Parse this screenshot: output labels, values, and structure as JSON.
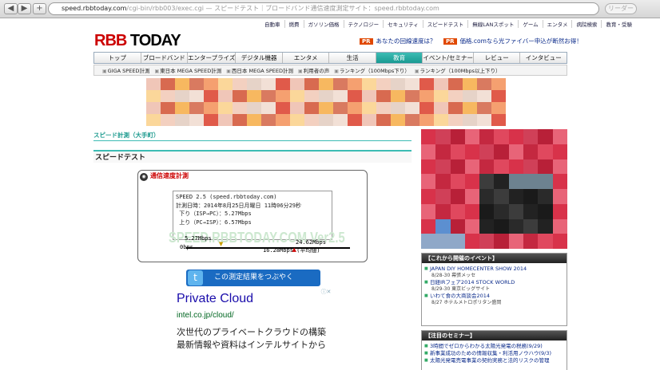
{
  "browser": {
    "url_host": "speed.rbbtoday.com",
    "url_rest": "/cgi-bin/rbb003/exec.cgi — スピードテスト｜ブロードバンド通信速度測定サイト：speed.rbbtoday.com",
    "reader_label": "リーダー",
    "back": "◀",
    "forward": "▶",
    "add": "+"
  },
  "util_links": [
    "自動車",
    "燃費",
    "ガソリン価格",
    "テクノロジー",
    "セキュリティ",
    "スピードテスト",
    "無線LANスポット",
    "ゲーム",
    "エンタメ",
    "病院検索",
    "教育・受験"
  ],
  "logo": {
    "r": "RBB",
    "rest": " TODAY"
  },
  "pr": [
    {
      "tag": "PR",
      "text": "あなたの回線速度は？"
    },
    {
      "tag": "PR",
      "text": "価格.comなら光ファイバー申込が断然お得！"
    }
  ],
  "nav": [
    "トップ",
    "ブロードバンド",
    "エンタープライズ",
    "デジタル機器",
    "エンタメ",
    "生活",
    "教育",
    "イベント/セミナー",
    "レビュー",
    "インタビュー"
  ],
  "subnav": [
    "GIGA SPEED計測",
    "東日本 MEGA SPEED計測",
    "西日本 MEGA SPEED計測",
    "利用者の声",
    "ランキング（100Mbps下り）",
    "ランキング（100Mbps以上下り）"
  ],
  "crumb": "スピード計測（大手町）",
  "heading": "スピードテスト",
  "test_box": {
    "title": "通信速度計測",
    "lines": [
      "SPEED 2.5 (speed.rbbtoday.com)",
      "計測日時：2014年8月25日月曜日 11時06分29秒",
      " 下り（ISP→PC）：5.27Mbps",
      " 上り（PC→ISP）：6.57Mbps"
    ],
    "watermark": "SPEED.RBBTODAY.COM Ver2.5",
    "current": "5.27Mbps",
    "zero": "0bps",
    "max": "24.62Mbps",
    "avg": "16.28Mbps (平均値)",
    "current_fraction": 0.214,
    "avg_fraction": 0.661
  },
  "tweet_button": "この測定結果をつぶやく",
  "ad": {
    "title": "Private Cloud",
    "url": "intel.co.jp/cloud/",
    "desc": "次世代のプライベートクラウドの構築 最新情報や資料はインテルサイトから",
    "info": "ⓘ✕"
  },
  "events": {
    "heading": "【これから開催のイベント】",
    "items": [
      {
        "title": "JAPAN DIY HOMECENTER SHOW 2014",
        "sub": "8/28-30 幕張メッセ"
      },
      {
        "title": "日経IRフェア2014 STOCK WORLD",
        "sub": "8/29-30 東京ビッグサイト"
      },
      {
        "title": "いわて食の大商談会2014",
        "sub": "8/27 ホテルメトロポリタン盛岡"
      }
    ]
  },
  "seminars": {
    "heading": "【注目のセミナー】",
    "items": [
      "3時間でゼロからわかる太陽光発電の税務(9/29)",
      "新事業成功のための情報収集・利活用ノウハウ(9/3)",
      "太陽光発電売電事業の契約実務と法的リスクの管理"
    ]
  }
}
